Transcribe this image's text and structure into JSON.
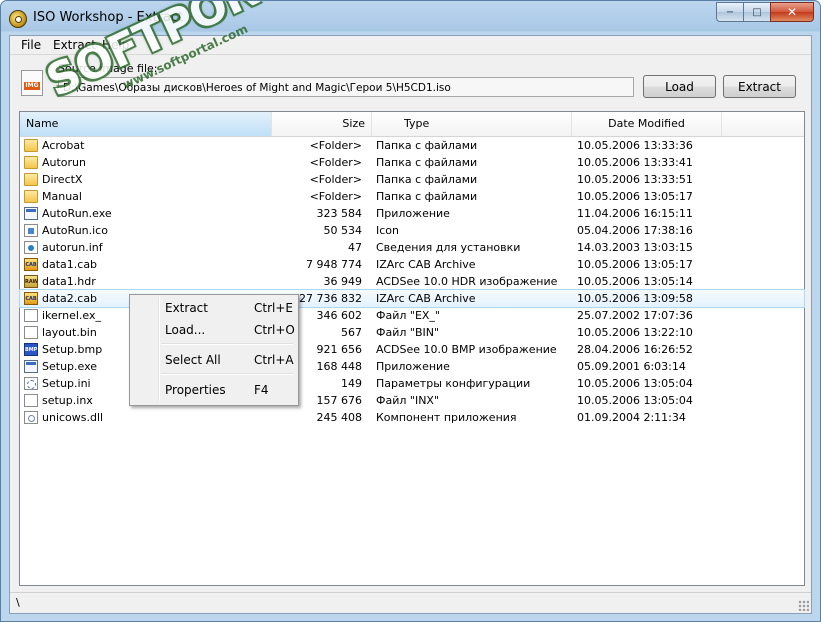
{
  "window": {
    "title": "ISO Workshop - Extract",
    "buttons": {
      "minimize": "−",
      "maximize": "□",
      "close": "✕"
    }
  },
  "menu": [
    "File",
    "Extract",
    "Help"
  ],
  "source": {
    "label": "Source image file:",
    "path": "D:\\Games\\Образы дисков\\Heroes of Might and Magic\\Герои 5\\H5CD1.iso",
    "icon_tag": "IMG"
  },
  "buttons": {
    "load": "Load",
    "extract": "Extract"
  },
  "columns": {
    "name": "Name",
    "size": "Size",
    "type": "Type",
    "date": "Date Modified"
  },
  "files": [
    {
      "name": "Acrobat",
      "size": "<Folder>",
      "type": "Папка с файлами",
      "date": "10.05.2006 13:33:36",
      "icon": "folder"
    },
    {
      "name": "Autorun",
      "size": "<Folder>",
      "type": "Папка с файлами",
      "date": "10.05.2006 13:33:41",
      "icon": "folder"
    },
    {
      "name": "DirectX",
      "size": "<Folder>",
      "type": "Папка с файлами",
      "date": "10.05.2006 13:33:51",
      "icon": "folder"
    },
    {
      "name": "Manual",
      "size": "<Folder>",
      "type": "Папка с файлами",
      "date": "10.05.2006 13:05:17",
      "icon": "folder"
    },
    {
      "name": "AutoRun.exe",
      "size": "323 584",
      "type": "Приложение",
      "date": "11.04.2006 16:15:11",
      "icon": "exe"
    },
    {
      "name": "AutoRun.ico",
      "size": "50 534",
      "type": "Icon",
      "date": "05.04.2006 17:38:16",
      "icon": "ico"
    },
    {
      "name": "autorun.inf",
      "size": "47",
      "type": "Сведения для установки",
      "date": "14.03.2003 13:03:15",
      "icon": "inf"
    },
    {
      "name": "data1.cab",
      "size": "7 948 774",
      "type": "IZArc CAB Archive",
      "date": "10.05.2006 13:05:17",
      "icon": "cab"
    },
    {
      "name": "data1.hdr",
      "size": "36 949",
      "type": "ACDSee 10.0 HDR изображение",
      "date": "10.05.2006 13:05:14",
      "icon": "hdr"
    },
    {
      "name": "data2.cab",
      "size": "527 736 832",
      "type": "IZArc CAB Archive",
      "date": "10.05.2006 13:09:58",
      "icon": "cab",
      "selected": true
    },
    {
      "name": "ikernel.ex_",
      "size": "346 602",
      "type": "Файл \"EX_\"",
      "date": "25.07.2002 17:07:36",
      "icon": "doc"
    },
    {
      "name": "layout.bin",
      "size": "567",
      "type": "Файл \"BIN\"",
      "date": "10.05.2006 13:22:10",
      "icon": "doc"
    },
    {
      "name": "Setup.bmp",
      "size": "921 656",
      "type": "ACDSee 10.0 BMP изображение",
      "date": "28.04.2006 16:26:52",
      "icon": "bmp"
    },
    {
      "name": "Setup.exe",
      "size": "168 448",
      "type": "Приложение",
      "date": "05.09.2001 6:03:14",
      "icon": "exe"
    },
    {
      "name": "Setup.ini",
      "size": "149",
      "type": "Параметры конфигурации",
      "date": "10.05.2006 13:05:04",
      "icon": "ini"
    },
    {
      "name": "setup.inx",
      "size": "157 676",
      "type": "Файл \"INX\"",
      "date": "10.05.2006 13:05:04",
      "icon": "doc"
    },
    {
      "name": "unicows.dll",
      "size": "245 408",
      "type": "Компонент приложения",
      "date": "01.09.2004 2:11:34",
      "icon": "dll"
    }
  ],
  "context_menu": [
    {
      "label": "Extract",
      "shortcut": "Ctrl+E"
    },
    {
      "label": "Load...",
      "shortcut": "Ctrl+O"
    },
    {
      "label": "Select All",
      "shortcut": "Ctrl+A"
    },
    {
      "label": "Properties",
      "shortcut": "F4"
    }
  ],
  "status": "\\",
  "watermark": {
    "brand": "SOFTPORTAL",
    "tm": "TM",
    "url": "www.softportal.com"
  }
}
